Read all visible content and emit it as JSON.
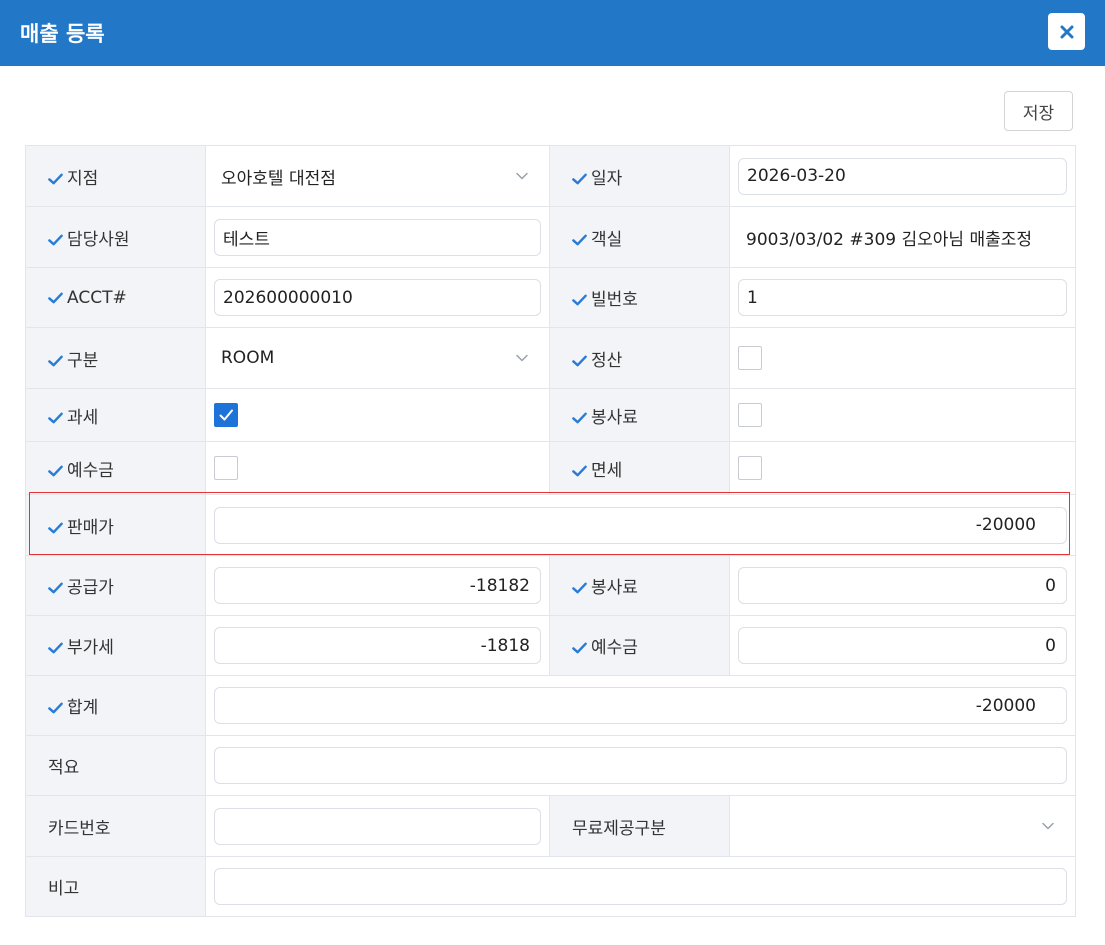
{
  "dialog": {
    "title": "매출 등록"
  },
  "toolbar": {
    "save_label": "저장"
  },
  "rows": {
    "branch": {
      "label": "지점",
      "value": "오아호텔 대전점"
    },
    "date": {
      "label": "일자",
      "value": "2026-03-20"
    },
    "staff": {
      "label": "담당사원",
      "value": "테스트"
    },
    "room": {
      "label": "객실",
      "value": "9003/03/02 #309 김오아님 매출조정"
    },
    "acct": {
      "label": "ACCT#",
      "value": "202600000010"
    },
    "bill_no": {
      "label": "빌번호",
      "value": "1"
    },
    "category": {
      "label": "구분",
      "value": "ROOM"
    },
    "settled": {
      "label": "정산",
      "checked": false
    },
    "taxable": {
      "label": "과세",
      "checked": true
    },
    "service_fee_flag": {
      "label": "봉사료",
      "checked": false
    },
    "deposit_flag": {
      "label": "예수금",
      "checked": false
    },
    "tax_free": {
      "label": "면세",
      "checked": false
    },
    "sale_price": {
      "label": "판매가",
      "value": "-20000"
    },
    "supply_price": {
      "label": "공급가",
      "value": "-18182"
    },
    "service_fee": {
      "label": "봉사료",
      "value": "0"
    },
    "vat": {
      "label": "부가세",
      "value": "-1818"
    },
    "deposit": {
      "label": "예수금",
      "value": "0"
    },
    "total": {
      "label": "합계",
      "value": "-20000"
    },
    "memo": {
      "label": "적요",
      "value": ""
    },
    "card_no": {
      "label": "카드번호",
      "value": ""
    },
    "free_type": {
      "label": "무료제공구분",
      "value": ""
    },
    "remarks": {
      "label": "비고",
      "value": ""
    }
  },
  "colors": {
    "header": "#2277c6",
    "check": "#1e73d8",
    "highlight": "#e23434"
  }
}
